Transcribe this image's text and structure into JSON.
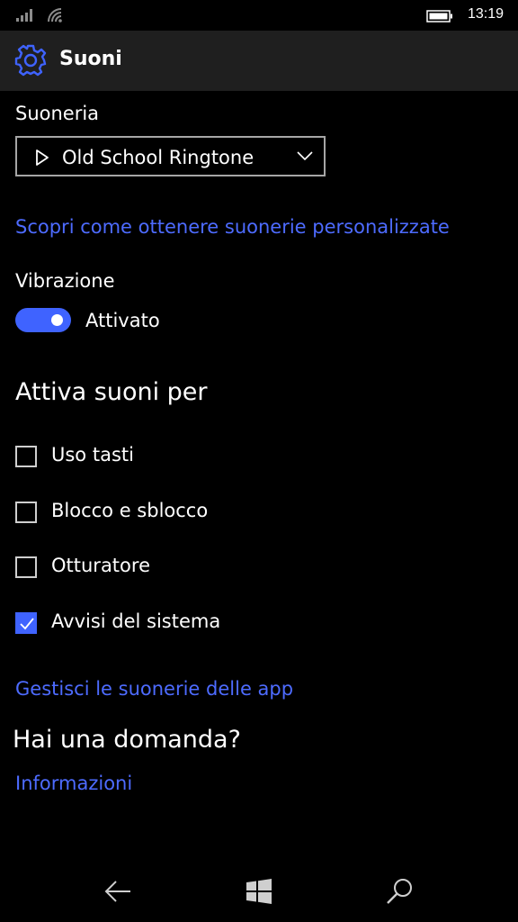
{
  "status_bar": {
    "time": "13:19",
    "icons": [
      "signal-icon",
      "wifi-icon",
      "battery-icon"
    ]
  },
  "header": {
    "title": "Suoni",
    "icon": "gear-icon"
  },
  "ringtone": {
    "label": "Suoneria",
    "selected": "Old School Ringtone",
    "play_icon": "play-icon",
    "chevron_icon": "chevron-down-icon"
  },
  "custom_ringtones_link": "Scopri come ottenere suonerie personalizzate",
  "vibration": {
    "label": "Vibrazione",
    "state_label": "Attivato",
    "on": true
  },
  "sounds_section": {
    "heading": "Attiva suoni per",
    "items": [
      {
        "label": "Uso tasti",
        "checked": false
      },
      {
        "label": "Blocco e sblocco",
        "checked": false
      },
      {
        "label": "Otturatore",
        "checked": false
      },
      {
        "label": "Avvisi del sistema",
        "checked": true
      }
    ]
  },
  "app_ringtones_link": "Gestisci le suonerie delle app",
  "help": {
    "heading": "Hai una domanda?",
    "link": "Informazioni"
  },
  "nav_bar": {
    "icons": [
      "back-icon",
      "windows-icon",
      "search-icon"
    ]
  },
  "colors": {
    "accent": "#3f63ff",
    "link": "#4d6bff",
    "background": "#000000",
    "header_background": "#1f1f1f"
  }
}
